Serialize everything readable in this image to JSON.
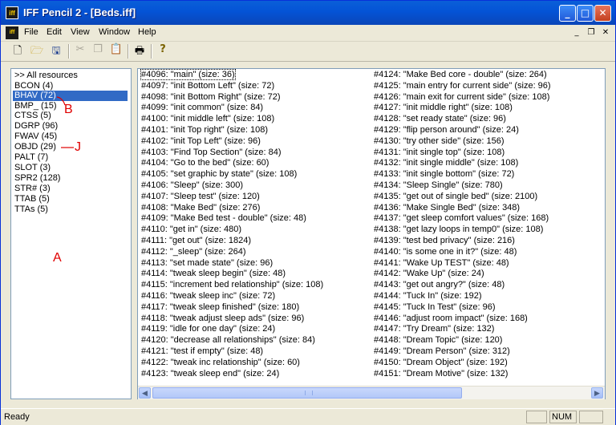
{
  "window": {
    "title": "IFF Pencil 2 - [Beds.iff]",
    "app_icon": "iff"
  },
  "menu": {
    "items": [
      "File",
      "Edit",
      "View",
      "Window",
      "Help"
    ]
  },
  "resources": [
    ">> All resources",
    "BCON (4)",
    "BHAV (72)",
    "BMP_ (15)",
    "CTSS (5)",
    "DGRP (96)",
    "FWAV (45)",
    "OBJD (29)",
    "PALT (7)",
    "SLOT (3)",
    "SPR2 (128)",
    "STR# (3)",
    "TTAB (5)",
    "TTAs (5)"
  ],
  "annotations": {
    "b": "B",
    "j": "J",
    "a": "A"
  },
  "list_left": [
    "#4096: \"main\" (size: 36)",
    "#4097: \"init Bottom Left\" (size: 72)",
    "#4098: \"init Bottom Right\" (size: 72)",
    "#4099: \"init common\" (size: 84)",
    "#4100: \"init middle left\" (size: 108)",
    "#4101: \"init Top right\" (size: 108)",
    "#4102: \"init Top Left\" (size: 96)",
    "#4103: \"Find Top Section\" (size: 84)",
    "#4104: \"Go to the bed\" (size: 60)",
    "#4105: \"set graphic by state\" (size: 108)",
    "#4106: \"Sleep\" (size: 300)",
    "#4107: \"Sleep test\" (size: 120)",
    "#4108: \"Make Bed\" (size: 276)",
    "#4109: \"Make Bed test - double\" (size: 48)",
    "#4110: \"get in\" (size: 480)",
    "#4111: \"get out\" (size: 1824)",
    "#4112: \"_sleep\" (size: 264)",
    "#4113: \"set made state\" (size: 96)",
    "#4114: \"tweak sleep begin\" (size: 48)",
    "#4115: \"increment bed relationship\" (size: 108)",
    "#4116: \"tweak sleep inc\" (size: 72)",
    "#4117: \"tweak sleep finished\" (size: 180)",
    "#4118: \"tweak adjust sleep ads\" (size: 96)",
    "#4119: \"idle for one day\" (size: 24)",
    "#4120: \"decrease all relationships\" (size: 84)",
    "#4121: \"test if empty\" (size: 48)",
    "#4122: \"tweak inc relationship\" (size: 60)",
    "#4123: \"tweak sleep end\" (size: 24)"
  ],
  "list_right": [
    "#4124: \"Make Bed core - double\" (size: 264)",
    "#4125: \"main entry for current side\" (size: 96)",
    "#4126: \"main exit for current side\" (size: 108)",
    "#4127: \"init middle right\" (size: 108)",
    "#4128: \"set ready state\" (size: 96)",
    "#4129: \"flip person around\" (size: 24)",
    "#4130: \"try other side\" (size: 156)",
    "#4131: \"init single top\" (size: 108)",
    "#4132: \"init single middle\" (size: 108)",
    "#4133: \"init single bottom\" (size: 72)",
    "#4134: \"Sleep Single\" (size: 780)",
    "#4135: \"get out of single bed\" (size: 2100)",
    "#4136: \"Make Single Bed\" (size: 348)",
    "#4137: \"get sleep comfort values\" (size: 168)",
    "#4138: \"get lazy loops in temp0\" (size: 108)",
    "#4139: \"test bed privacy\" (size: 216)",
    "#4140: \"is some one in it?\" (size: 48)",
    "#4141: \"Wake Up TEST\" (size: 48)",
    "#4142: \"Wake Up\" (size: 24)",
    "#4143: \"get out angry?\" (size: 48)",
    "#4144: \"Tuck In\" (size: 192)",
    "#4145: \"Tuck In Test\" (size: 96)",
    "#4146: \"adjust room impact\" (size: 168)",
    "#4147: \"Try Dream\" (size: 132)",
    "#4148: \"Dream Topic\" (size: 120)",
    "#4149: \"Dream Person\" (size: 312)",
    "#4150: \"Dream Object\" (size: 192)",
    "#4151: \"Dream Motive\" (size: 132)"
  ],
  "status": {
    "text": "Ready",
    "num": "NUM"
  }
}
